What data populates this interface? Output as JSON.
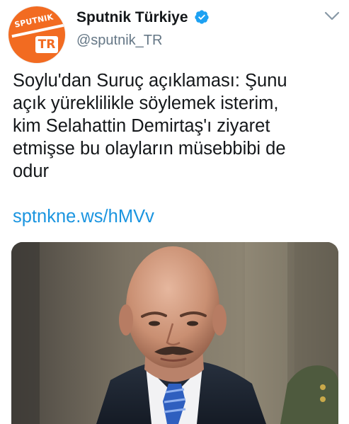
{
  "account": {
    "avatar_label": "SPUTNIK",
    "avatar_badge": "TR",
    "display_name": "Sputnik Türkiye",
    "handle": "@sputnik_TR",
    "verified": true
  },
  "tweet": {
    "text": "Soylu'dan Suruç açıklaması: Şunu\naçık yüreklilikle söylemek isterim,\nkim Selahattin Demirtaş'ı ziyaret\netmişse bu olayların müsebbibi de\nodur",
    "link": "sptnkne.ws/hMVv"
  },
  "icons": {
    "verified": "verified-badge-icon",
    "menu": "chevron-down-icon"
  },
  "colors": {
    "brand_orange": "#f26b21",
    "link_blue": "#1b95e0",
    "verified_blue": "#1da1f2",
    "muted_gray": "#657786"
  }
}
